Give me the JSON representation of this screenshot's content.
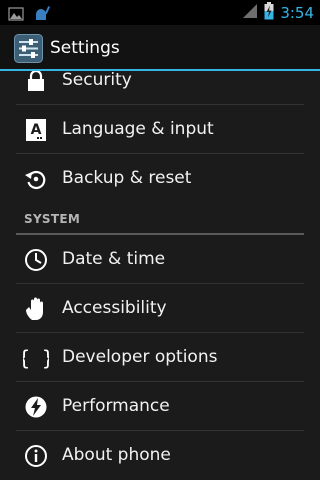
{
  "status_bar": {
    "time": "3:54",
    "icons": [
      "image-notification-icon",
      "android-debug-icon",
      "signal-icon",
      "battery-charging-icon"
    ]
  },
  "action_bar": {
    "title": "Settings",
    "icon": "settings-sliders-icon"
  },
  "items": [
    {
      "label": "Security",
      "icon": "lock-icon"
    },
    {
      "label": "Language & input",
      "icon": "keyboard-a-icon"
    },
    {
      "label": "Backup & reset",
      "icon": "backup-restore-icon"
    },
    {
      "label": "Date & time",
      "icon": "clock-icon"
    },
    {
      "label": "Accessibility",
      "icon": "hand-icon"
    },
    {
      "label": "Developer options",
      "icon": "braces-icon"
    },
    {
      "label": "Performance",
      "icon": "lightning-icon"
    },
    {
      "label": "About phone",
      "icon": "info-icon"
    }
  ],
  "section": {
    "system_label": "SYSTEM"
  },
  "colors": {
    "accent": "#33b5e5",
    "background": "#1b1b1b"
  }
}
